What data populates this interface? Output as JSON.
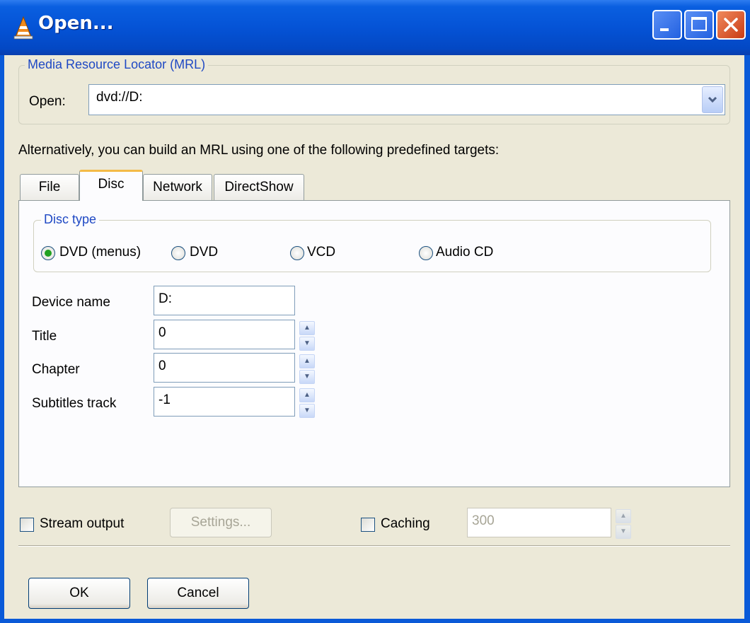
{
  "window": {
    "title": "Open..."
  },
  "mrl": {
    "legend": "Media Resource Locator (MRL)",
    "open_label": "Open:",
    "open_value": "dvd://D:"
  },
  "hint": "Alternatively, you can build an MRL using one of the following predefined targets:",
  "tabs": [
    {
      "label": "File",
      "active": false
    },
    {
      "label": "Disc",
      "active": true
    },
    {
      "label": "Network",
      "active": false
    },
    {
      "label": "DirectShow",
      "active": false
    }
  ],
  "disc_type": {
    "legend": "Disc type",
    "options": [
      {
        "label": "DVD (menus)",
        "selected": true
      },
      {
        "label": "DVD",
        "selected": false
      },
      {
        "label": "VCD",
        "selected": false
      },
      {
        "label": "Audio CD",
        "selected": false
      }
    ]
  },
  "fields": {
    "device_name": {
      "label": "Device name",
      "value": "D:"
    },
    "title": {
      "label": "Title",
      "value": "0"
    },
    "chapter": {
      "label": "Chapter",
      "value": "0"
    },
    "subtitles": {
      "label": "Subtitles track",
      "value": "-1"
    }
  },
  "stream_output": {
    "label": "Stream output",
    "checked": false,
    "settings_label": "Settings..."
  },
  "caching": {
    "label": "Caching",
    "checked": false,
    "value": "300"
  },
  "buttons": {
    "ok": "OK",
    "cancel": "Cancel"
  },
  "colors": {
    "titlebar": "#0553d6",
    "legend": "#1f49c4",
    "tab_highlight": "#f4bb47",
    "radio_dot": "#21a121"
  }
}
